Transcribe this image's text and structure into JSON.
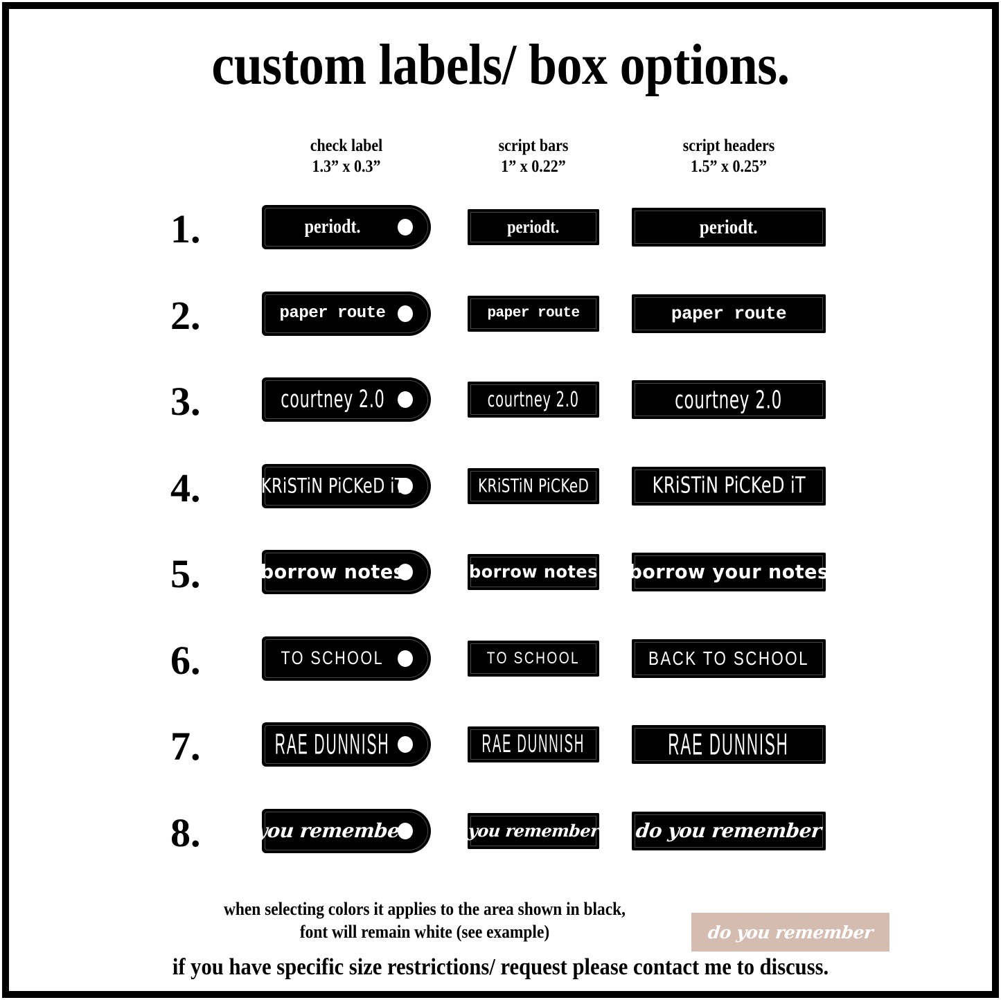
{
  "title": "custom labels/ box options.",
  "columns": [
    {
      "name": "check label",
      "size": "1.3” x 0.3”"
    },
    {
      "name": "script bars",
      "size": "1” x 0.22”"
    },
    {
      "name": "script headers",
      "size": "1.5” x 0.25”"
    }
  ],
  "rows": [
    {
      "number": "1.",
      "check_label": "periodt.",
      "script_bar": "periodt.",
      "script_header": "periodt.",
      "font_class": "f-serifbold",
      "tag_size": 28,
      "bar_size": 26,
      "hdr_size": 29
    },
    {
      "number": "2.",
      "check_label": "paper route",
      "script_bar": "paper route",
      "script_header": "paper route",
      "font_class": "f-typewriter",
      "tag_size": 24,
      "bar_size": 21,
      "hdr_size": 26
    },
    {
      "number": "3.",
      "check_label": "courtney 2.0",
      "script_bar": "courtney 2.0",
      "script_header": "courtney 2.0",
      "font_class": "f-tallhand",
      "tag_size": 31,
      "bar_size": 27,
      "hdr_size": 32
    },
    {
      "number": "4.",
      "check_label": "KRiSTiN PiCKeD iT",
      "script_bar": "KRiSTiN PiCKeD",
      "script_header": "KRiSTiN PiCKeD iT",
      "font_class": "f-bouncy",
      "tag_size": 28,
      "bar_size": 25,
      "hdr_size": 30
    },
    {
      "number": "5.",
      "check_label": "borrow notes",
      "script_bar": "borrow notes",
      "script_header": "borrow your notes",
      "font_class": "f-marker",
      "tag_size": 27,
      "bar_size": 24,
      "hdr_size": 27
    },
    {
      "number": "6.",
      "check_label": "TO SCHOOL",
      "script_bar": "TO SCHOOL",
      "script_header": "BACK TO SCHOOL",
      "font_class": "f-thincaps",
      "tag_size": 27,
      "bar_size": 24,
      "hdr_size": 28
    },
    {
      "number": "7.",
      "check_label": "RAE DUNNISH",
      "script_bar": "RAE DUNNISH",
      "script_header": "RAE DUNNISH",
      "font_class": "f-raedunn",
      "tag_size": 34,
      "bar_size": 30,
      "hdr_size": 36
    },
    {
      "number": "8.",
      "check_label": "you remember",
      "script_bar": "you remember",
      "script_header": "do you remember",
      "font_class": "f-script",
      "tag_size": 28,
      "bar_size": 24,
      "hdr_size": 28
    }
  ],
  "footer": {
    "note_line1": "when selecting colors it applies to the area shown in black,",
    "note_line2": "font will remain white  (see example)",
    "example_text": "do you remember",
    "example_bg": "#d4bdb0",
    "contact": "if you have specific size restrictions/ request please contact me to discuss."
  },
  "colors": {
    "frame": "#000000",
    "chip_bg": "#000000",
    "chip_text": "#ffffff",
    "page_bg": "#ffffff"
  }
}
